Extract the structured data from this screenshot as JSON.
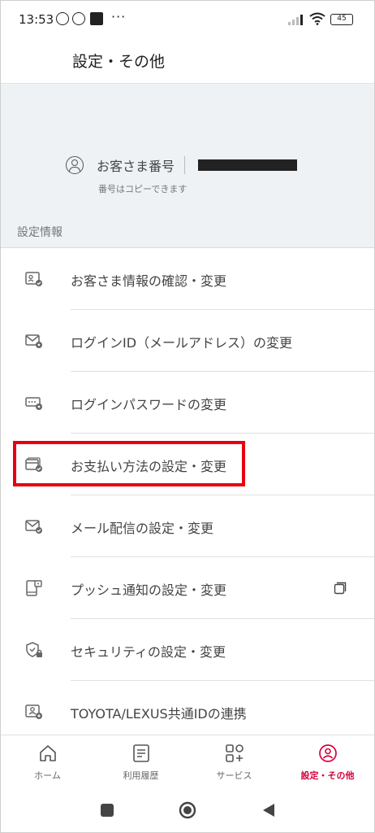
{
  "status_bar": {
    "time": "13:53",
    "more": "···",
    "battery": "45"
  },
  "header": {
    "title": "設定・その他"
  },
  "customer": {
    "label": "お客さま番号",
    "note": "番号はコピーできます"
  },
  "section": {
    "title": "設定情報"
  },
  "menu": {
    "items": [
      {
        "label": "お客さま情報の確認・変更",
        "icon": "user-card-check-icon"
      },
      {
        "label": "ログインID（メールアドレス）の変更",
        "icon": "mail-gear-icon"
      },
      {
        "label": "ログインパスワードの変更",
        "icon": "password-gear-icon"
      },
      {
        "label": "お支払い方法の設定・変更",
        "icon": "payment-card-check-icon"
      },
      {
        "label": "メール配信の設定・変更",
        "icon": "mail-check-icon"
      },
      {
        "label": "プッシュ通知の設定・変更",
        "icon": "push-notification-icon"
      },
      {
        "label": "セキュリティの設定・変更",
        "icon": "security-shield-icon"
      },
      {
        "label": "TOYOTA/LEXUS共通IDの連携",
        "icon": "id-link-icon"
      }
    ]
  },
  "bottom_nav": {
    "items": [
      {
        "label": "ホーム",
        "icon": "home-icon"
      },
      {
        "label": "利用履歴",
        "icon": "history-icon"
      },
      {
        "label": "サービス",
        "icon": "services-icon"
      },
      {
        "label": "設定・その他",
        "icon": "settings-user-icon",
        "active": true
      }
    ]
  },
  "colors": {
    "accent": "#d6003b",
    "highlight": "#e60012",
    "card_bg": "#eef2f5"
  }
}
